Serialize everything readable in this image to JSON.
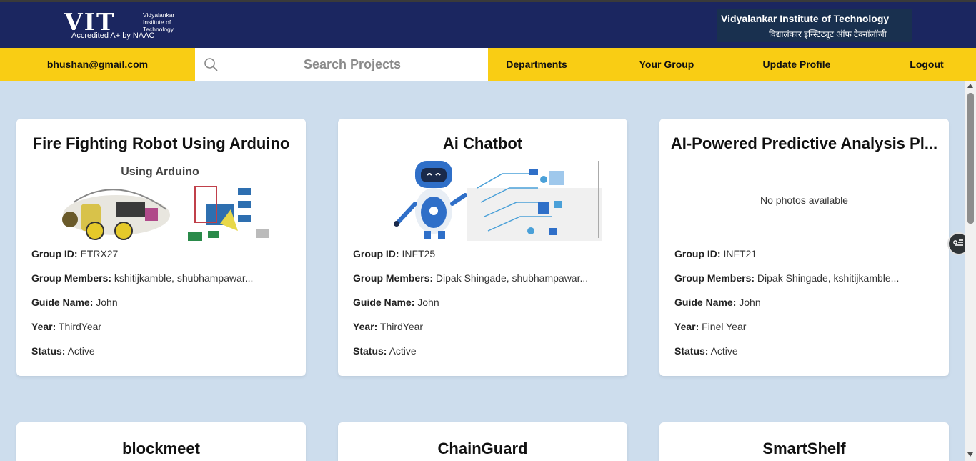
{
  "header": {
    "logo_text": "VIT",
    "logo_sub": [
      "Vidyalankar",
      "Institute of",
      "Technology"
    ],
    "logo_accreditation": "Accredited A+ by NAAC",
    "institute_name_en": "Vidyalankar Institute of Technology",
    "institute_name_hi": "विद्यालंकार इन्स्टिट्यूट ऑफ टेक्नॉलॉजी"
  },
  "navbar": {
    "email": "bhushan@gmail.com",
    "search_placeholder": "Search Projects",
    "links": [
      "Departments",
      "Your Group",
      "Update Profile",
      "Logout"
    ]
  },
  "labels": {
    "group_id": "Group ID:",
    "group_members": "Group Members:",
    "guide_name": "Guide Name:",
    "year": "Year:",
    "status": "Status:"
  },
  "projects": [
    {
      "title": "Fire Fighting Robot Using Arduino",
      "photo": "Using Arduino",
      "group_id": "ETRX27",
      "members": "kshitijkamble, shubhampawar...",
      "guide": "John",
      "year": "ThirdYear",
      "status": "Active"
    },
    {
      "title": "Ai Chatbot",
      "photo": "chatbot-robot-illustration",
      "group_id": "INFT25",
      "members": "Dipak Shingade, shubhampawar...",
      "guide": "John",
      "year": "ThirdYear",
      "status": "Active"
    },
    {
      "title": "AI-Powered Predictive Analysis Pl...",
      "no_photo": "No photos available",
      "group_id": "INFT21",
      "members": "Dipak Shingade, kshitijkamble...",
      "guide": "John",
      "year": "Finel Year",
      "status": "Active"
    },
    {
      "title": "blockmeet"
    },
    {
      "title": "ChainGuard"
    },
    {
      "title": "SmartShelf"
    }
  ],
  "icons": {
    "search": "search-icon",
    "floating": "filter-list-icon"
  }
}
